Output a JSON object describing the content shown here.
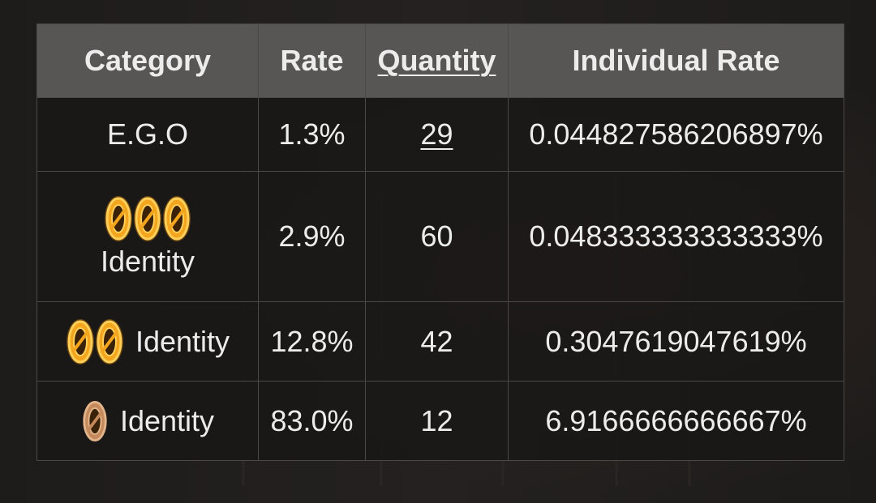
{
  "table": {
    "headers": [
      "Category",
      "Rate",
      "Quantity",
      "Individual Rate"
    ],
    "rows": [
      {
        "category": "E.G.O",
        "rate": "1.3%",
        "quantity": "29",
        "individual_rate": "0.044827586206897%",
        "icon_count": 0
      },
      {
        "category": "Identity",
        "rate": "2.9%",
        "quantity": "60",
        "individual_rate": "0.048333333333333%",
        "icon_count": 3
      },
      {
        "category": "Identity",
        "rate": "12.8%",
        "quantity": "42",
        "individual_rate": "0.3047619047619%",
        "icon_count": 2
      },
      {
        "category": "Identity",
        "rate": "83.0%",
        "quantity": "12",
        "individual_rate": "6.9166666666667%",
        "icon_count": 1
      }
    ]
  },
  "icons": {
    "gold_icon": "rarity-gold-icon",
    "bronze_icon": "rarity-bronze-icon"
  },
  "colors": {
    "header_bg": "#575655",
    "body_bg": "#181716",
    "gold": "#f2a51d",
    "bronze": "#c48a5c",
    "text": "#ececec"
  }
}
